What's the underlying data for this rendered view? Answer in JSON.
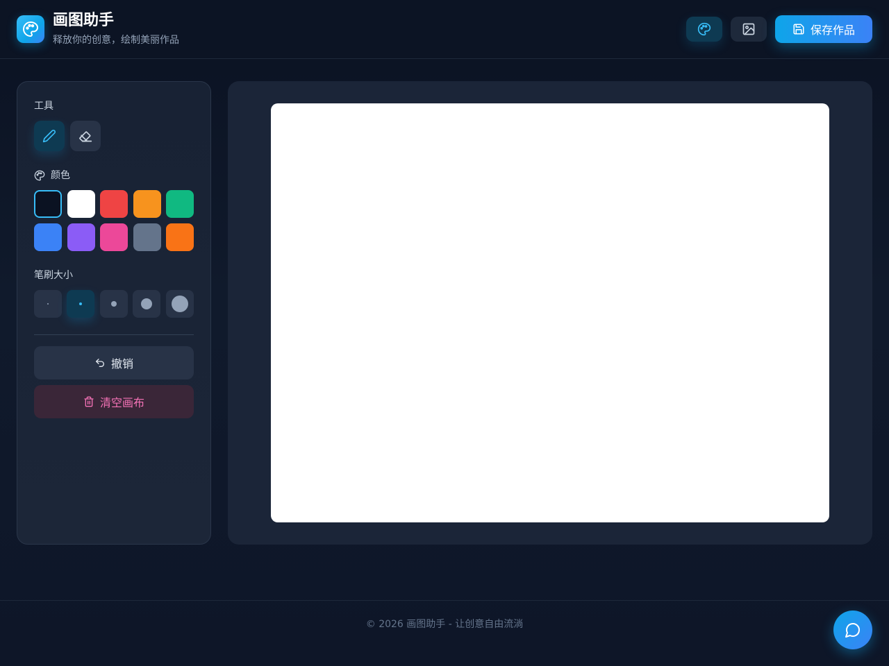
{
  "header": {
    "title": "画图助手",
    "subtitle": "释放你的创意，绘制美丽作品",
    "logo_icon": "palette-icon",
    "palette_button_icon": "palette-icon",
    "image_button_icon": "image-icon",
    "save_label": "保存作品",
    "save_icon": "save-icon",
    "accent": "#0ea5e9"
  },
  "sidebar": {
    "tools_label": "工具",
    "tools": [
      {
        "name": "pencil",
        "icon": "pencil-icon",
        "active": true
      },
      {
        "name": "eraser",
        "icon": "eraser-icon",
        "active": false
      }
    ],
    "colors_label": "颜色",
    "colors_icon": "palette-icon",
    "colors": [
      "#0b1222",
      "#ffffff",
      "#ef4444",
      "#f7931e",
      "#10b981",
      "#3b82f6",
      "#8b5cf6",
      "#ec4899",
      "#64748b",
      "#f97316"
    ],
    "selected_color": "#0b1222",
    "brush_label": "笔刷大小",
    "brush_sizes": [
      "xs",
      "s",
      "m",
      "l",
      "xl"
    ],
    "selected_brush": "s",
    "undo_label": "撤销",
    "undo_icon": "undo-icon",
    "clear_label": "清空画布",
    "clear_icon": "trash-icon",
    "clear_color": "#f472b6"
  },
  "canvas": {
    "background": "#ffffff"
  },
  "footer": {
    "text": "© 2026 画图助手 - 让创意自由流淌"
  },
  "chat": {
    "icon": "chat-bubble-icon"
  }
}
